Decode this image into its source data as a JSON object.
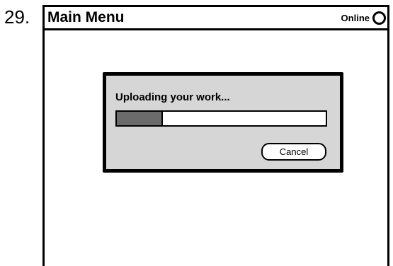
{
  "step_number": "29.",
  "title_bar": {
    "title": "Main Menu",
    "status_label": "Online",
    "status_icon": "circle-icon"
  },
  "dialog": {
    "message": "Uploading your work...",
    "progress_fraction": 0.22,
    "cancel_label": "Cancel"
  }
}
